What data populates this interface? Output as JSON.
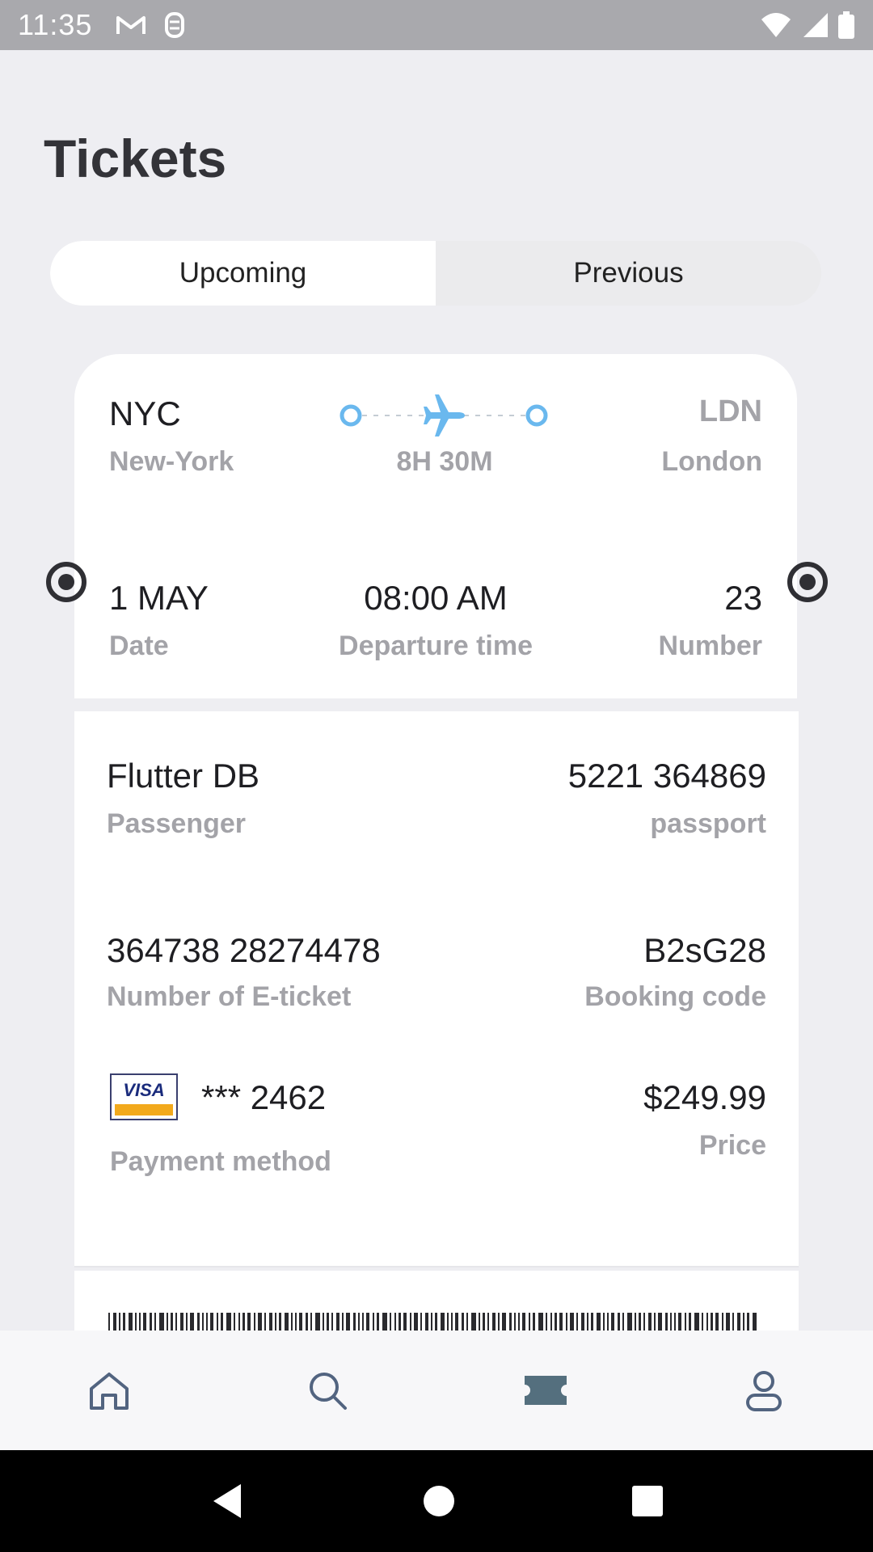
{
  "status_bar": {
    "time": "11:35"
  },
  "page": {
    "title": "Tickets"
  },
  "tabs": [
    {
      "label": "Upcoming",
      "active": true
    },
    {
      "label": "Previous",
      "active": false
    }
  ],
  "route": {
    "from_code": "NYC",
    "from_city": "New-York",
    "to_code": "LDN",
    "to_city": "London",
    "duration": "8H 30M",
    "accent_color": "#6ab8ee"
  },
  "flight": {
    "date": "1 MAY",
    "date_label": "Date",
    "departure_time": "08:00 AM",
    "departure_label": "Departure time",
    "number": "23",
    "number_label": "Number"
  },
  "passenger": {
    "name": "Flutter DB",
    "name_label": "Passenger",
    "passport": "5221 364869",
    "passport_label": "passport",
    "eticket": "364738 28274478",
    "eticket_label": "Number of E-ticket",
    "booking_code": "B2sG28",
    "booking_label": "Booking code"
  },
  "payment": {
    "card_brand": "VISA",
    "card_number": "*** 2462",
    "method_label": "Payment method",
    "price": "$249.99",
    "price_label": "Price"
  },
  "bottom_nav": [
    {
      "icon": "home-icon"
    },
    {
      "icon": "search-icon"
    },
    {
      "icon": "ticket-icon",
      "active": true
    },
    {
      "icon": "profile-icon"
    }
  ],
  "colors": {
    "nav_icon": "#526480",
    "nav_active": "#546f7e",
    "muted_text": "#a3a3a8"
  }
}
